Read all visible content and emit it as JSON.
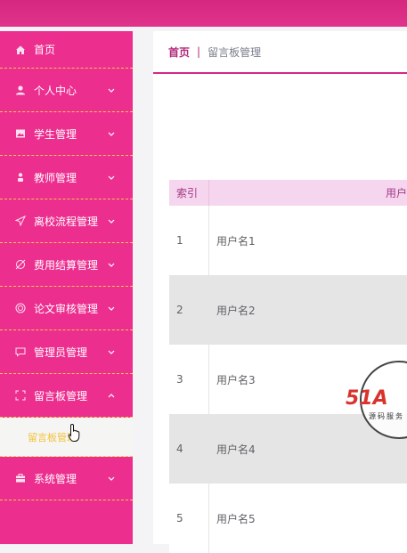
{
  "sidebar": {
    "items": [
      {
        "label": "首页",
        "icon": "home-icon"
      },
      {
        "label": "个人中心",
        "icon": "user-icon"
      },
      {
        "label": "学生管理",
        "icon": "image-icon"
      },
      {
        "label": "教师管理",
        "icon": "person-icon"
      },
      {
        "label": "离校流程管理",
        "icon": "send-icon"
      },
      {
        "label": "费用结算管理",
        "icon": "money-icon"
      },
      {
        "label": "论文审核管理",
        "icon": "circle-icon"
      },
      {
        "label": "管理员管理",
        "icon": "chat-icon"
      },
      {
        "label": "留言板管理",
        "icon": "fullscreen-icon"
      },
      {
        "label": "系统管理",
        "icon": "briefcase-icon"
      }
    ],
    "submenu_label": "留言板管理"
  },
  "breadcrumb": {
    "home": "首页",
    "separator": "|",
    "current": "留言板管理"
  },
  "table": {
    "headers": [
      "索引",
      "用户"
    ],
    "rows": [
      {
        "index": "1",
        "user": "用户名1"
      },
      {
        "index": "2",
        "user": "用户名2"
      },
      {
        "index": "3",
        "user": "用户名3"
      },
      {
        "index": "4",
        "user": "用户名4"
      },
      {
        "index": "5",
        "user": "用户名5"
      }
    ]
  },
  "watermark": {
    "brand": "51A",
    "sub": "源码服务"
  },
  "colors": {
    "topbar": "#d6277f",
    "sidebar": "#ec2e8f",
    "accent": "#f3c64c",
    "header_bg": "#f6d6ee"
  }
}
